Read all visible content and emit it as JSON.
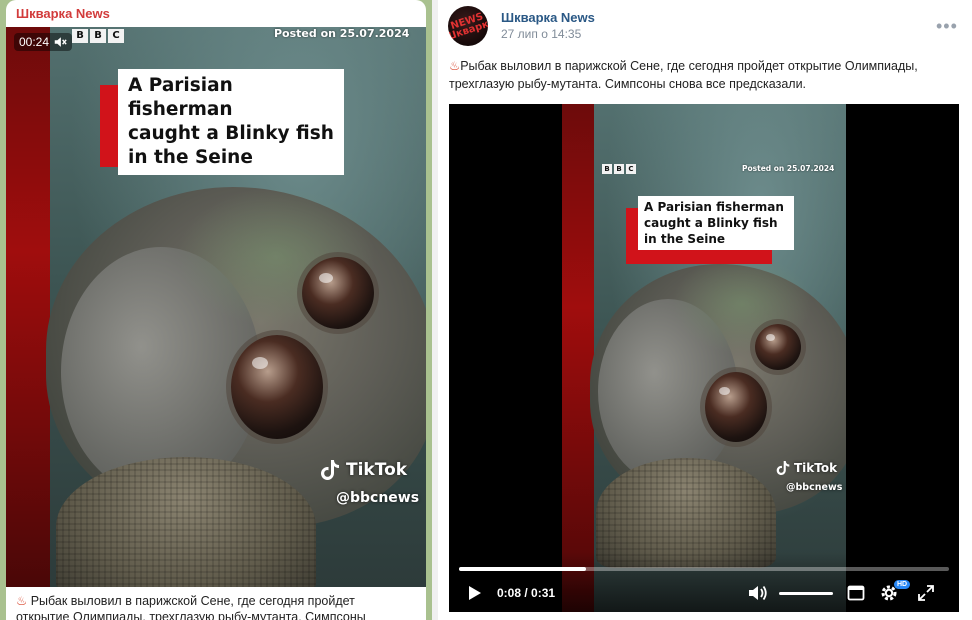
{
  "left_post": {
    "channel": "Шкварка News",
    "video": {
      "elapsed": "00:24",
      "bbc": [
        "B",
        "B",
        "C"
      ],
      "posted": "Posted on 25.07.2024",
      "title_lines": [
        "A Parisian fisherman",
        "caught a Blinky fish",
        "in the Seine"
      ],
      "tiktok": "TikTok",
      "handle": "@bbcnews"
    },
    "caption_emoji": "♨",
    "caption_text": "Рыбак выловил в парижской Сене, где сегодня пройдет",
    "caption_text_2": "открытие Олимпиады, трехглазую рыбу-мутанта. Симпсоны"
  },
  "right_post": {
    "channel": "Шкварка News",
    "avatar_text": "NEWS Шкварка",
    "date": "27 лип о 14:35",
    "menu": "•••",
    "caption_emoji": "♨",
    "caption_line_1": "Рыбак выловил в парижской Сене, где сегодня пройдет открытие Олимпиады,",
    "caption_line_2": "трехглазую рыбу-мутанта. Симпсоны снова все предсказали.",
    "video": {
      "bbc": [
        "B",
        "B",
        "C"
      ],
      "posted": "Posted on 25.07.2024",
      "title_lines": [
        "A Parisian fisherman",
        "caught a Blinky fish",
        "in the Seine"
      ],
      "tiktok": "TikTok",
      "handle": "@bbcnews"
    },
    "player": {
      "time": "0:08 / 0:31",
      "progress_fraction": 0.26,
      "hd_badge": "HD"
    }
  },
  "colors": {
    "left_channel": "#d23b3b",
    "right_channel": "#2a5885",
    "bbc_red": "#d1131a",
    "progress": "#ffffff",
    "hd_badge": "#2787f5"
  },
  "icons": [
    "mute-icon",
    "play-icon",
    "volume-icon",
    "miniplayer-icon",
    "gear-icon",
    "fullscreen-icon",
    "tiktok-logo-icon",
    "more-options-icon"
  ]
}
